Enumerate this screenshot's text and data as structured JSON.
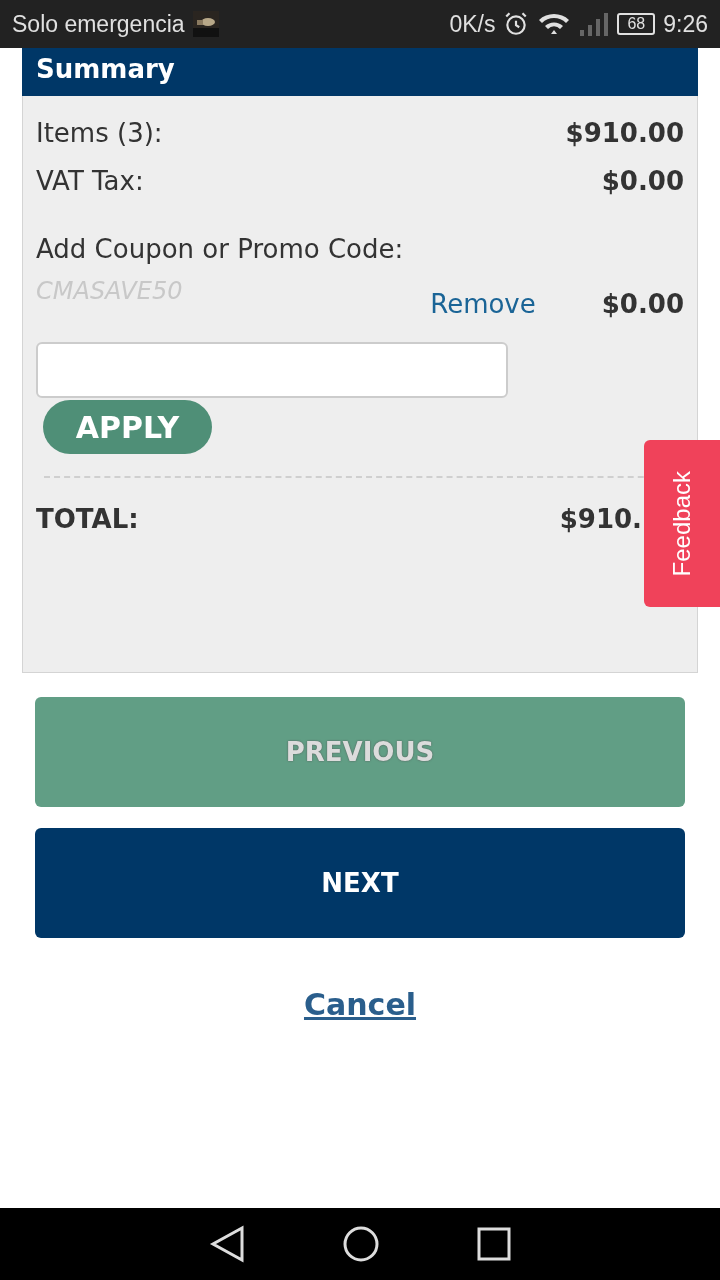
{
  "status_bar": {
    "carrier": "Solo emergencia",
    "speed": "0K/s",
    "battery": "68",
    "time": "9:26"
  },
  "summary": {
    "title": "Summary",
    "lines": [
      {
        "label": "Items (3):",
        "value": "$910.00"
      },
      {
        "label": "VAT Tax:",
        "value": "$0.00"
      }
    ],
    "coupon": {
      "label": "Add Coupon or Promo Code:",
      "applied_code": "CMASAVE50",
      "remove": "Remove",
      "discount": "$0.00",
      "apply": "APPLY"
    },
    "total": {
      "label": "TOTAL:",
      "value": "$910."
    }
  },
  "feedback": "Feedback",
  "buttons": [
    {
      "label": "PREVIOUS",
      "disabled": true
    },
    {
      "label": "NEXT",
      "disabled": false
    }
  ],
  "cancel": "Cancel"
}
